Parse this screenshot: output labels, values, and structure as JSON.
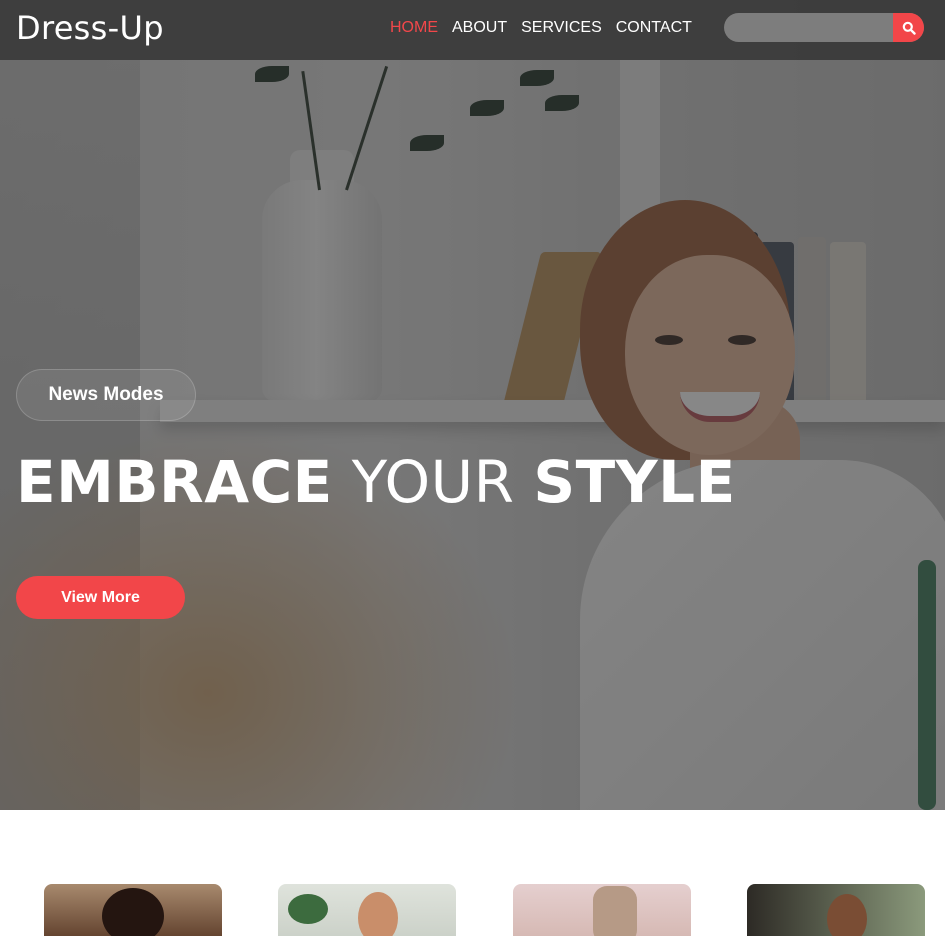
{
  "header": {
    "logo": "Dress-Up",
    "nav": [
      {
        "label": "HOME",
        "active": true
      },
      {
        "label": "ABOUT",
        "active": false
      },
      {
        "label": "SERVICES",
        "active": false
      },
      {
        "label": "CONTACT",
        "active": false
      }
    ],
    "search": {
      "placeholder": "",
      "icon": "search-icon"
    }
  },
  "hero": {
    "tag": "News Modes",
    "headline": {
      "part1": "EMBRACE",
      "part2": "YOUR",
      "part3": "STYLE"
    },
    "cta_label": "View More"
  },
  "cards": [
    {
      "image": "woman-curly-hair-photo"
    },
    {
      "image": "woman-with-plants-photo"
    },
    {
      "image": "fabric-roll-photo"
    },
    {
      "image": "woman-sewing-photo"
    }
  ],
  "colors": {
    "accent": "#f24649",
    "header_bg": "#3a3a3a",
    "text_light": "#ffffff"
  }
}
